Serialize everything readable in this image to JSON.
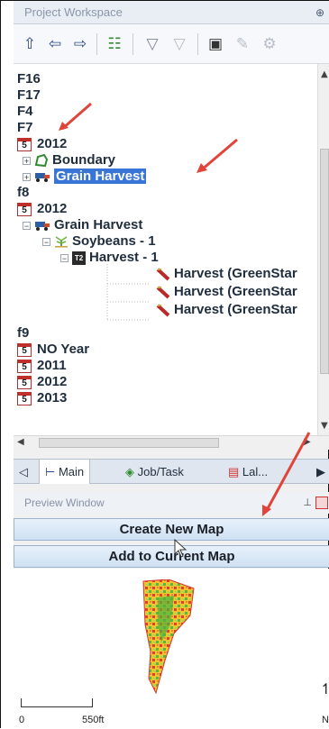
{
  "workspace": {
    "title": "Project Workspace",
    "pin_glyph": "⊕"
  },
  "toolbar": {
    "buttons": [
      {
        "icon": "arrow-up-icon",
        "glyph": "⇧"
      },
      {
        "icon": "arrow-left-icon",
        "glyph": "⇦"
      },
      {
        "icon": "arrow-right-icon",
        "glyph": "⇨"
      },
      {
        "icon": "tree-view-icon",
        "glyph": "☷"
      },
      {
        "icon": "filter-icon",
        "glyph": "▽"
      },
      {
        "icon": "filter-disabled-icon",
        "glyph": "▽"
      },
      {
        "icon": "properties-icon",
        "glyph": "▣"
      },
      {
        "icon": "edit-disabled-icon",
        "glyph": "✎"
      },
      {
        "icon": "tool-disabled-icon",
        "glyph": "⚙"
      }
    ]
  },
  "tree": {
    "f16": "F16",
    "f17": "F17",
    "f4": "F4",
    "f7": "F7",
    "f7_year": "2012",
    "boundary": "Boundary",
    "grain_harvest_selected": "Grain Harvest",
    "f8": "f8",
    "f8_year": "2012",
    "f8_grain_harvest": "Grain Harvest",
    "soybeans": "Soybeans - 1",
    "harvest_1": "Harvest - 1",
    "harvest_items": [
      "Harvest (GreenStar",
      "Harvest (GreenStar",
      "Harvest (GreenStar"
    ],
    "f9": "f9",
    "f9_years": [
      "NO Year",
      "2011",
      "2012",
      "2013"
    ],
    "cal_glyph": "5",
    "op_glyph": "T2"
  },
  "tabs": {
    "main": "Main",
    "job_task": "Job/Task",
    "third": "Lal..."
  },
  "preview": {
    "title": "Preview Window",
    "create_new_map": "Create New Map",
    "add_to_current_map": "Add to Current Map"
  },
  "map": {
    "scale_start": "0",
    "scale_end": "550ft",
    "north_label": "N"
  },
  "colors": {
    "selection": "#3875d7",
    "annotation_arrow": "#e0443a"
  }
}
